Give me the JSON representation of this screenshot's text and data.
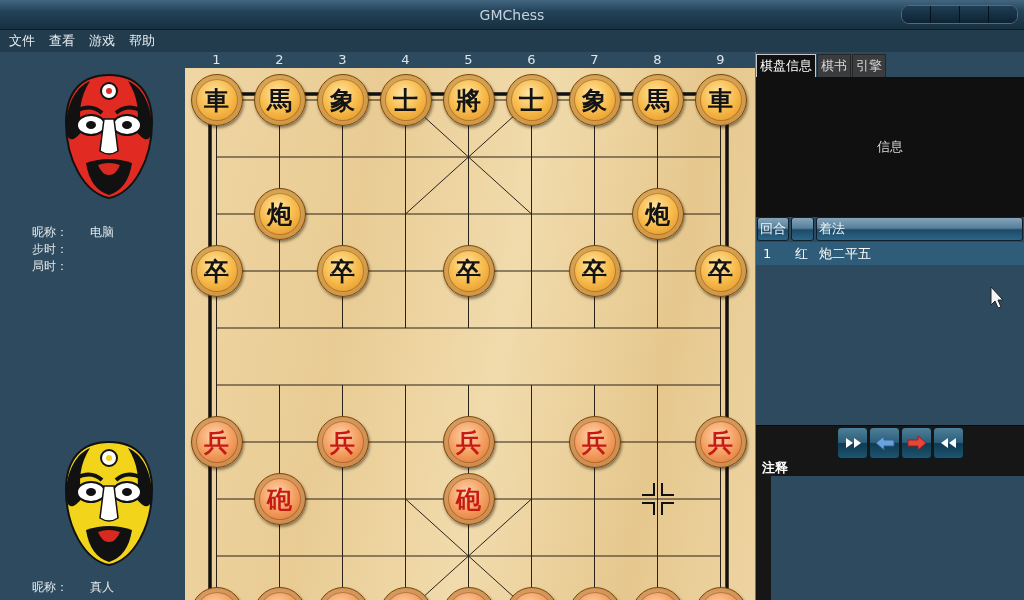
{
  "window": {
    "title": "GMChess"
  },
  "menu": [
    {
      "label": "文件"
    },
    {
      "label": "查看"
    },
    {
      "label": "游戏"
    },
    {
      "label": "帮助"
    }
  ],
  "players": [
    {
      "color": "#e02a22",
      "fields": [
        {
          "label": "昵称：",
          "value": "电脑"
        },
        {
          "label": "步时："
        },
        {
          "label": "局时："
        }
      ]
    },
    {
      "color": "#f2d41a",
      "fields": [
        {
          "label": "昵称：",
          "value": "真人"
        }
      ]
    }
  ],
  "board": {
    "files": [
      "1",
      "2",
      "3",
      "4",
      "5",
      "6",
      "7",
      "8",
      "9"
    ],
    "ranks": [
      [
        {
          "kind": "black",
          "label": "車"
        },
        {
          "kind": "black",
          "label": "馬"
        },
        {
          "kind": "black",
          "label": "象"
        },
        {
          "kind": "black",
          "label": "士"
        },
        {
          "kind": "black",
          "label": "將"
        },
        {
          "kind": "black",
          "label": "士"
        },
        {
          "kind": "black",
          "label": "象"
        },
        {
          "kind": "black",
          "label": "馬"
        },
        {
          "kind": "black",
          "label": "車"
        }
      ],
      [
        {
          "kind": "empty"
        },
        {
          "kind": "empty"
        },
        {
          "kind": "empty"
        },
        {
          "kind": "empty"
        },
        {
          "kind": "empty"
        },
        {
          "kind": "empty"
        },
        {
          "kind": "empty"
        },
        {
          "kind": "empty"
        },
        {
          "kind": "empty"
        }
      ],
      [
        {
          "kind": "empty"
        },
        {
          "kind": "black",
          "label": "炮"
        },
        {
          "kind": "empty"
        },
        {
          "kind": "empty"
        },
        {
          "kind": "empty"
        },
        {
          "kind": "empty"
        },
        {
          "kind": "empty"
        },
        {
          "kind": "black",
          "label": "炮"
        },
        {
          "kind": "empty"
        }
      ],
      [
        {
          "kind": "black",
          "label": "卒"
        },
        {
          "kind": "empty"
        },
        {
          "kind": "black",
          "label": "卒"
        },
        {
          "kind": "empty"
        },
        {
          "kind": "black",
          "label": "卒"
        },
        {
          "kind": "empty"
        },
        {
          "kind": "black",
          "label": "卒"
        },
        {
          "kind": "empty"
        },
        {
          "kind": "black",
          "label": "卒"
        }
      ],
      [
        {
          "kind": "empty"
        },
        {
          "kind": "empty"
        },
        {
          "kind": "empty"
        },
        {
          "kind": "empty"
        },
        {
          "kind": "empty"
        },
        {
          "kind": "empty"
        },
        {
          "kind": "empty"
        },
        {
          "kind": "empty"
        },
        {
          "kind": "empty"
        }
      ],
      [
        {
          "kind": "empty"
        },
        {
          "kind": "empty"
        },
        {
          "kind": "empty"
        },
        {
          "kind": "empty"
        },
        {
          "kind": "empty"
        },
        {
          "kind": "empty"
        },
        {
          "kind": "empty"
        },
        {
          "kind": "empty"
        },
        {
          "kind": "empty"
        }
      ],
      [
        {
          "kind": "red",
          "label": "兵"
        },
        {
          "kind": "empty"
        },
        {
          "kind": "red",
          "label": "兵"
        },
        {
          "kind": "empty"
        },
        {
          "kind": "red",
          "label": "兵"
        },
        {
          "kind": "empty"
        },
        {
          "kind": "red",
          "label": "兵"
        },
        {
          "kind": "empty"
        },
        {
          "kind": "red",
          "label": "兵"
        }
      ],
      [
        {
          "kind": "empty"
        },
        {
          "kind": "red",
          "label": "砲"
        },
        {
          "kind": "empty"
        },
        {
          "kind": "empty"
        },
        {
          "kind": "red",
          "label": "砲"
        },
        {
          "kind": "empty"
        },
        {
          "kind": "empty"
        },
        {
          "kind": "marker"
        },
        {
          "kind": "empty"
        }
      ],
      [
        {
          "kind": "empty"
        },
        {
          "kind": "empty"
        },
        {
          "kind": "empty"
        },
        {
          "kind": "empty"
        },
        {
          "kind": "empty"
        },
        {
          "kind": "empty"
        },
        {
          "kind": "empty"
        },
        {
          "kind": "empty"
        },
        {
          "kind": "empty"
        }
      ],
      [
        {
          "kind": "red"
        },
        {
          "kind": "red"
        },
        {
          "kind": "red"
        },
        {
          "kind": "red"
        },
        {
          "kind": "red"
        },
        {
          "kind": "red"
        },
        {
          "kind": "red"
        },
        {
          "kind": "red"
        },
        {
          "kind": "red"
        }
      ]
    ]
  },
  "side_panel": {
    "tabs": [
      {
        "label": "棋盘信息",
        "selected": true
      },
      {
        "label": "棋书",
        "selected": false
      },
      {
        "label": "引擎",
        "selected": false
      }
    ],
    "info_text": "信息",
    "columns": [
      {
        "label": "回合"
      },
      {},
      {
        "label": "着法"
      }
    ],
    "rows": [
      {
        "round": "1",
        "side": "红",
        "move": "炮二平五",
        "selected": true
      }
    ],
    "notes_label": "注释"
  }
}
